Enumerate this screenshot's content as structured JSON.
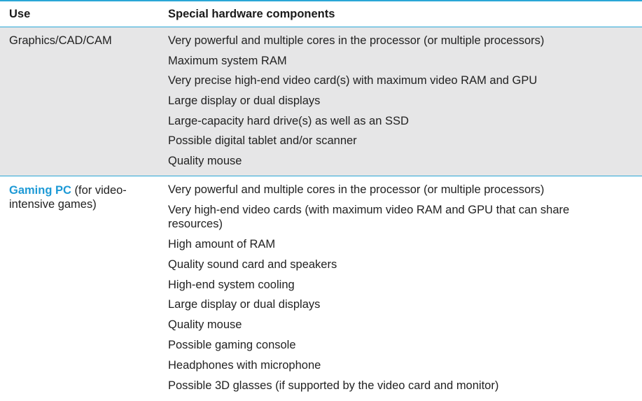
{
  "table": {
    "header": {
      "use": "Use",
      "components": "Special hardware components"
    },
    "rows": [
      {
        "use_text": "Graphics/CAD/CAM",
        "components": [
          "Very powerful and multiple cores in the processor (or multiple processors)",
          "Maximum system RAM",
          "Very precise high-end video card(s) with maximum video RAM and GPU",
          "Large display or dual displays",
          "Large-capacity hard drive(s) as well as an SSD",
          "Possible digital tablet and/or scanner",
          "Quality mouse"
        ]
      },
      {
        "use_highlight": "Gaming PC",
        "use_text": " (for video-intensive games)",
        "components": [
          "Very powerful and multiple cores in the processor (or multiple processors)",
          "Very high-end video cards (with maximum video RAM and GPU that can share resources)",
          "High amount of RAM",
          "Quality sound card and speakers",
          "High-end system cooling",
          "Large display or dual displays",
          "Quality mouse",
          "Possible gaming console",
          "Headphones with microphone",
          "Possible 3D glasses (if supported by the video card and monitor)"
        ]
      }
    ]
  },
  "colors": {
    "accent_rule": "#2aa7d6",
    "highlight_text": "#1e9ad6",
    "shaded_row": "#e6e6e7"
  }
}
